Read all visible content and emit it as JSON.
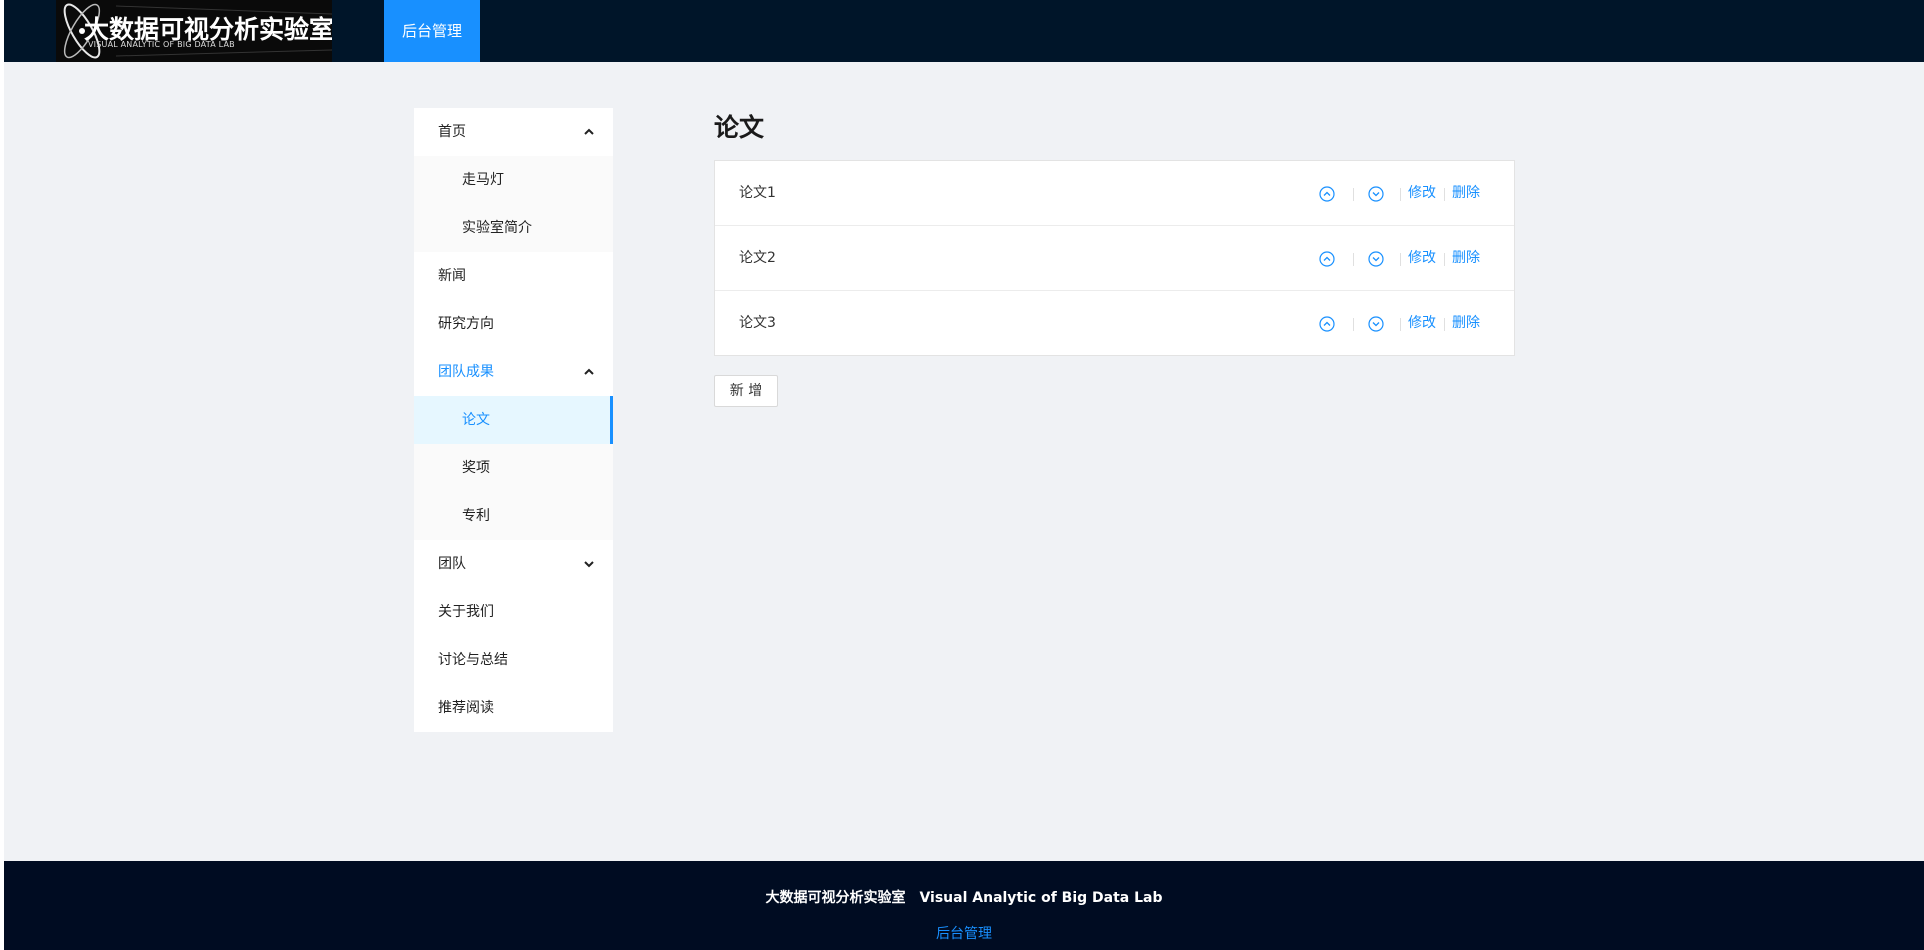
{
  "header": {
    "logo_title": "大数据可视分析实验室",
    "logo_subtitle": "VISUAL ANALYTIC OF BIG DATA LAB",
    "nav_item": "后台管理"
  },
  "sidebar": {
    "items": [
      {
        "label": "首页",
        "level": 1,
        "expanded": true
      },
      {
        "label": "走马灯",
        "level": 2
      },
      {
        "label": "实验室简介",
        "level": 2
      },
      {
        "label": "新闻",
        "level": 1
      },
      {
        "label": "研究方向",
        "level": 1
      },
      {
        "label": "团队成果",
        "level": 1,
        "expanded": true,
        "active": true
      },
      {
        "label": "论文",
        "level": 2,
        "selected": true
      },
      {
        "label": "奖项",
        "level": 2
      },
      {
        "label": "专利",
        "level": 2
      },
      {
        "label": "团队",
        "level": 1,
        "expanded": false
      },
      {
        "label": "关于我们",
        "level": 1
      },
      {
        "label": "讨论与总结",
        "level": 1
      },
      {
        "label": "推荐阅读",
        "level": 1
      }
    ]
  },
  "main": {
    "title": "论文",
    "rows": [
      {
        "title": "论文1",
        "edit": "修改",
        "delete": "删除"
      },
      {
        "title": "论文2",
        "edit": "修改",
        "delete": "删除"
      },
      {
        "title": "论文3",
        "edit": "修改",
        "delete": "删除"
      }
    ],
    "add_button": "新 增"
  },
  "footer": {
    "title_cn": "大数据可视分析实验室",
    "title_en": "Visual Analytic of Big Data Lab",
    "link": "后台管理"
  },
  "colors": {
    "header_bg": "#001529",
    "footer_bg": "#000c22",
    "accent": "#1890ff",
    "page_bg": "#f0f2f5"
  }
}
